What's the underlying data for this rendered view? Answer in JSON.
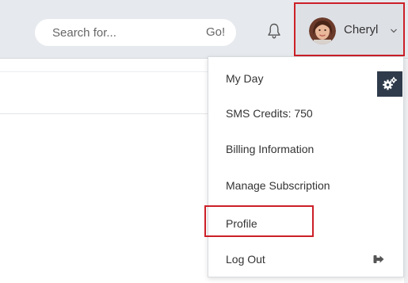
{
  "search": {
    "placeholder": "Search for...",
    "go_label": "Go!"
  },
  "header": {
    "notifications_icon": "bell-icon",
    "user": {
      "name": "Cheryl",
      "menu_icon": "chevron-down-icon",
      "avatar": "user-avatar"
    }
  },
  "settings": {
    "icon": "gears-icon"
  },
  "dropdown": {
    "items": [
      {
        "label": "My Day"
      },
      {
        "label": "SMS Credits: 750"
      },
      {
        "label": "Billing Information"
      },
      {
        "label": "Manage Subscription"
      },
      {
        "label": "Profile",
        "highlighted": true
      },
      {
        "label": "Log Out",
        "icon": "sign-out-icon"
      }
    ]
  },
  "colors": {
    "header_bg": "#e6e9ed",
    "highlight_border": "#cc1f27",
    "gear_badge_bg": "#2f3b4b"
  }
}
